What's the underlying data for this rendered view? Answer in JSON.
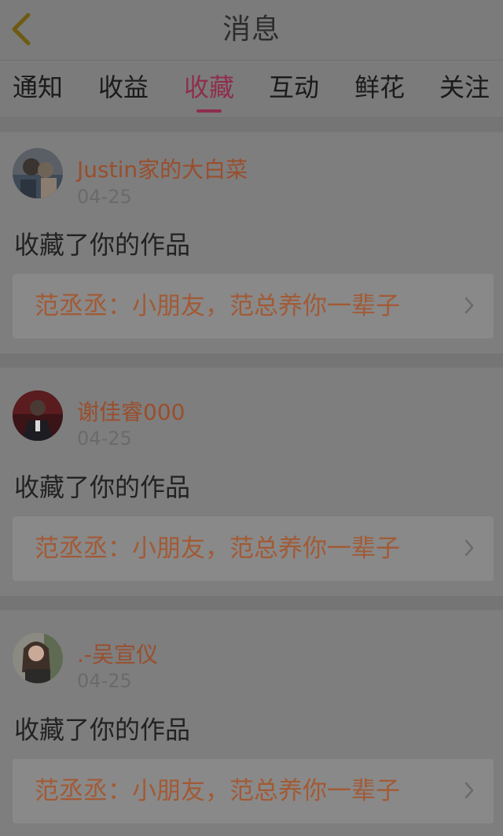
{
  "header": {
    "title": "消息",
    "back_icon": "chevron-left-icon"
  },
  "tabs": [
    {
      "label": "通知",
      "active": false
    },
    {
      "label": "收益",
      "active": false
    },
    {
      "label": "收藏",
      "active": true
    },
    {
      "label": "互动",
      "active": false
    },
    {
      "label": "鲜花",
      "active": false
    },
    {
      "label": "关注",
      "active": false
    }
  ],
  "messages": [
    {
      "username": "Justin家的大白菜",
      "time": "04-25",
      "action": "收藏了你的作品",
      "work_title": "范丞丞：小朋友，范总养你一辈子"
    },
    {
      "username": "谢佳睿000",
      "time": "04-25",
      "action": "收藏了你的作品",
      "work_title": "范丞丞：小朋友，范总养你一辈子"
    },
    {
      "username": ".-吴宣仪",
      "time": "04-25",
      "action": "收藏了你的作品",
      "work_title": "范丞丞：小朋友，范总养你一辈子"
    }
  ],
  "colors": {
    "background": "#7c7c7c",
    "accent": "#8f2e4c",
    "username": "#9a4e2c",
    "work_title": "#a25a35",
    "back_icon": "#6e5a12"
  }
}
